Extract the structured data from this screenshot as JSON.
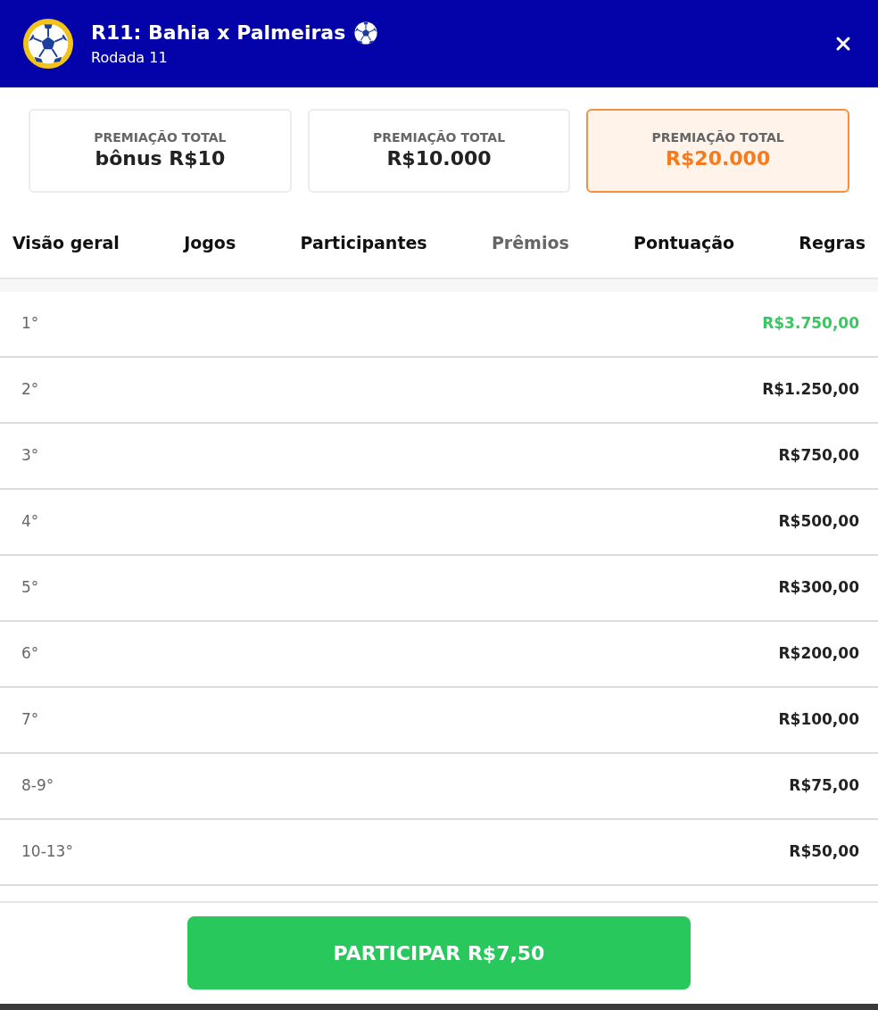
{
  "header": {
    "title": "R11: Bahia x Palmeiras",
    "subtitle": "Rodada 11"
  },
  "prize_cards": [
    {
      "label": "PREMIAÇÃO TOTAL",
      "value": "bônus R$10",
      "selected": false
    },
    {
      "label": "PREMIAÇÃO TOTAL",
      "value": "R$10.000",
      "selected": false
    },
    {
      "label": "PREMIAÇÃO TOTAL",
      "value": "R$20.000",
      "selected": true
    }
  ],
  "tabs": [
    {
      "label": "Visão geral",
      "selected": false
    },
    {
      "label": "Jogos",
      "selected": false
    },
    {
      "label": "Participantes",
      "selected": false
    },
    {
      "label": "Prêmios",
      "selected": true
    },
    {
      "label": "Pontuação",
      "selected": false
    },
    {
      "label": "Regras",
      "selected": false
    }
  ],
  "prizes": [
    {
      "position": "1°",
      "amount": "R$3.750,00",
      "highlighted": true
    },
    {
      "position": "2°",
      "amount": "R$1.250,00",
      "highlighted": false
    },
    {
      "position": "3°",
      "amount": "R$750,00",
      "highlighted": false
    },
    {
      "position": "4°",
      "amount": "R$500,00",
      "highlighted": false
    },
    {
      "position": "5°",
      "amount": "R$300,00",
      "highlighted": false
    },
    {
      "position": "6°",
      "amount": "R$200,00",
      "highlighted": false
    },
    {
      "position": "7°",
      "amount": "R$100,00",
      "highlighted": false
    },
    {
      "position": "8-9°",
      "amount": "R$75,00",
      "highlighted": false
    },
    {
      "position": "10-13°",
      "amount": "R$50,00",
      "highlighted": false
    }
  ],
  "footer": {
    "button": "PARTICIPAR R$7,50"
  }
}
